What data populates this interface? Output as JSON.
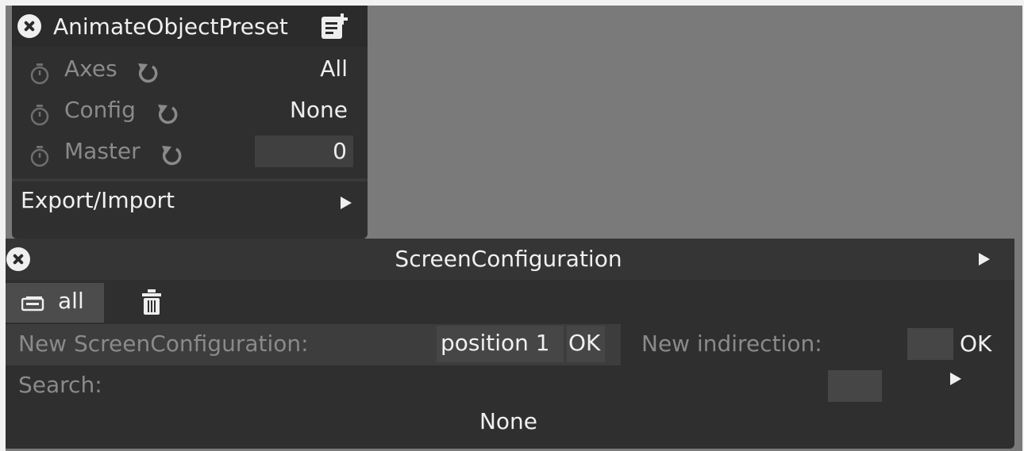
{
  "preset_panel": {
    "title": "AnimateObjectPreset",
    "params": [
      {
        "label": "Axes",
        "value": "All"
      },
      {
        "label": "Config",
        "value": "None"
      },
      {
        "label": "Master",
        "value": "0"
      }
    ],
    "export_label": "Export/Import"
  },
  "screen_panel": {
    "title": "ScreenConfiguration",
    "tab_all_label": "all",
    "new_config_label": "New ScreenConfiguration:",
    "new_config_value": "position 1",
    "ok_label": "OK",
    "new_indirection_label": "New indirection:",
    "search_label": "Search:",
    "empty_text": "None"
  },
  "icons": {
    "close": "close-icon",
    "doc_add": "doc-add-icon",
    "timer": "timer-icon",
    "reset": "reset-icon",
    "play": "play-icon",
    "list": "list-icon",
    "trash": "trash-icon"
  },
  "colors": {
    "canvas": "#7a7a7a",
    "panel": "#2f2f2f",
    "text": "#f0f0f0",
    "muted_text": "#8a8a8a"
  }
}
